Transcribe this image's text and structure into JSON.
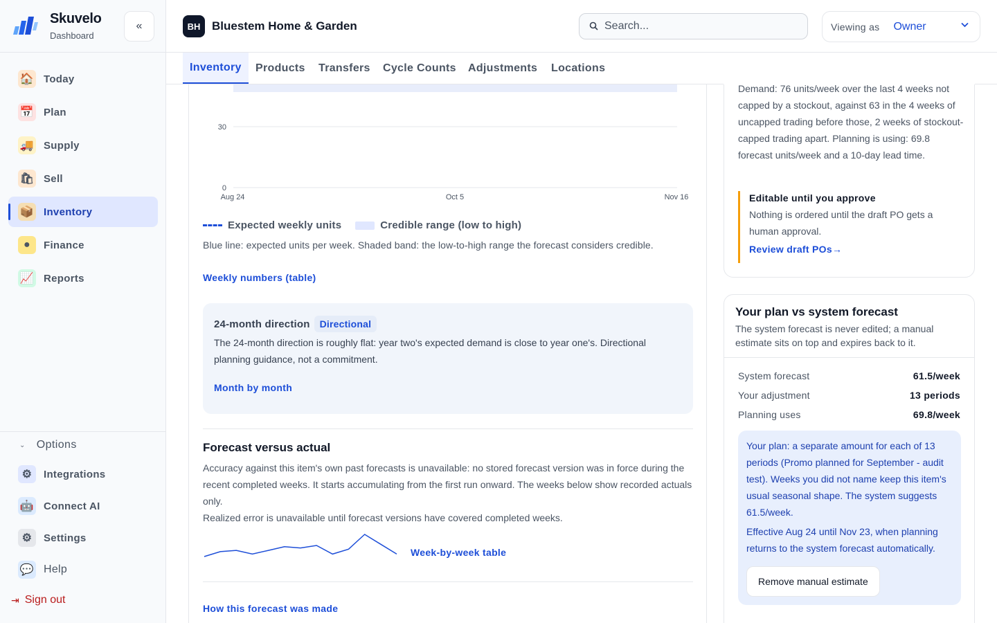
{
  "brand": {
    "name": "Skuvelo",
    "subtitle": "Dashboard"
  },
  "sidebar": {
    "collapse_icon": "double-chevron-left-icon",
    "items": [
      {
        "label": "Today",
        "icon": "house-icon"
      },
      {
        "label": "Plan",
        "icon": "calendar-icon"
      },
      {
        "label": "Supply",
        "icon": "truck-icon"
      },
      {
        "label": "Sell",
        "icon": "shopping-bag-icon"
      },
      {
        "label": "Inventory",
        "icon": "package-icon",
        "active": true
      },
      {
        "label": "Finance",
        "icon": "coin-icon"
      },
      {
        "label": "Reports",
        "icon": "chart-icon"
      }
    ],
    "options_label": "Options",
    "options": [
      {
        "label": "Integrations",
        "icon": "gears-icon"
      },
      {
        "label": "Connect AI",
        "icon": "robot-icon"
      },
      {
        "label": "Settings",
        "icon": "gear-icon"
      },
      {
        "label": "Help",
        "icon": "speech-bubble-icon"
      }
    ],
    "signout": "Sign out"
  },
  "header": {
    "workspace_initials": "BH",
    "workspace_name": "Bluestem Home & Garden",
    "search_placeholder": "Search...",
    "viewing_label": "Viewing as",
    "viewing_value": "Owner"
  },
  "tabs": [
    "Inventory",
    "Products",
    "Transfers",
    "Cycle Counts",
    "Adjustments",
    "Locations"
  ],
  "chart_data": {
    "type": "line",
    "x_ticks": [
      "Aug 24",
      "Oct 5",
      "Nov 16"
    ],
    "y_ticks": [
      0,
      30
    ],
    "series": [
      {
        "name": "Expected weekly units",
        "style": "dashed"
      },
      {
        "name": "Credible range (low to high)",
        "style": "band"
      }
    ]
  },
  "main": {
    "legend_expected": "Expected weekly units",
    "legend_band": "Credible range (low to high)",
    "caption": "Blue line: expected units per week. Shaded band: the low-to-high range the forecast considers credible.",
    "weekly_link": "Weekly numbers (table)",
    "direction": {
      "title": "24-month direction",
      "badge": "Directional",
      "text": "The 24-month direction is roughly flat: year two's expected demand is close to year one's. Directional planning guidance, not a commitment.",
      "link": "Month by month"
    },
    "fva": {
      "title": "Forecast versus actual",
      "text": "Accuracy against this item's own past forecasts is unavailable: no stored forecast version was in force during the recent completed weeks. It starts accumulating from the first run onward. The weeks below show recorded actuals only.",
      "text2": "Realized error is unavailable until forecast versions have covered completed weeks.",
      "week_link": "Week-by-week table",
      "sparkline_values": [
        6,
        8,
        8.5,
        7,
        8.5,
        10,
        9.5,
        10.5,
        7,
        9,
        15,
        11,
        7
      ]
    },
    "how_link": "How this forecast was made"
  },
  "right": {
    "demand_text": "Demand: 76 units/week over the last 4 weeks not capped by a stockout, against 63 in the 4 weeks of uncapped trading before those, 2 weeks of stockout-capped trading apart. Planning is using: 69.8 forecast units/week and a 10-day lead time.",
    "editable_title": "Editable until you approve",
    "editable_text": "Nothing is ordered until the draft PO gets a human approval.",
    "editable_link": "Review draft POs→",
    "plan_card": {
      "title": "Your plan vs system forecast",
      "subtitle": "The system forecast is never edited; a manual estimate sits on top and expires back to it.",
      "rows": [
        {
          "k": "System forecast",
          "v": "61.5/week"
        },
        {
          "k": "Your adjustment",
          "v": "13 periods"
        },
        {
          "k": "Planning uses",
          "v": "69.8/week"
        }
      ],
      "plan_text": "Your plan: a separate amount for each of 13 periods (Promo planned for September - audit test). Weeks you did not name keep this item's usual seasonal shape. The system suggests 61.5/week.",
      "plan_text2": "Effective Aug 24 until Nov 23, when planning returns to the system forecast automatically.",
      "remove_button": "Remove manual estimate"
    }
  }
}
